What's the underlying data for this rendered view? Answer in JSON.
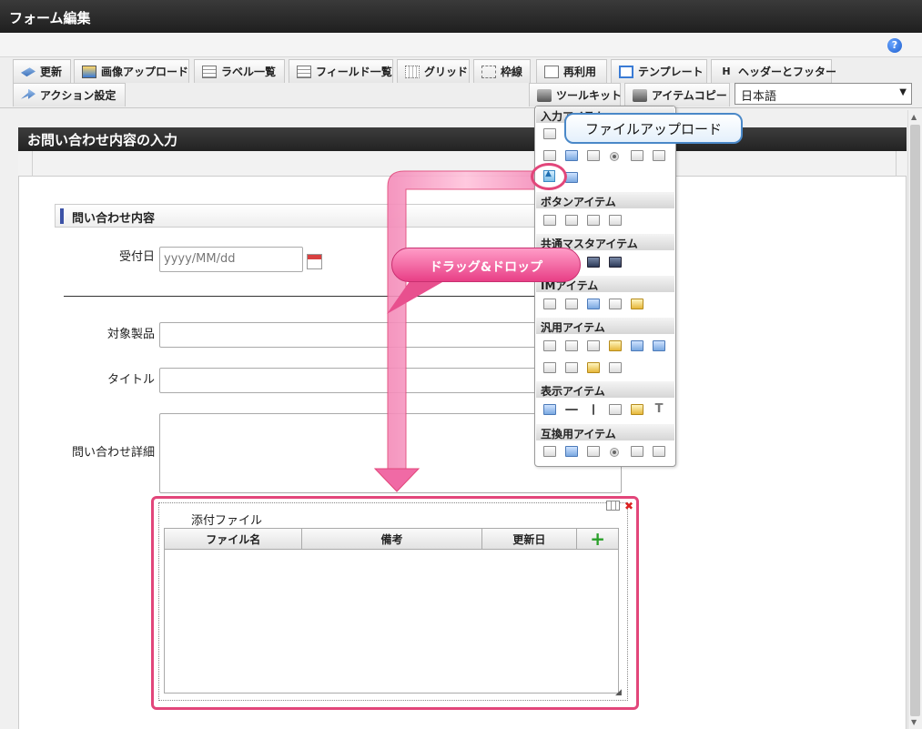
{
  "window": {
    "title": "フォーム編集"
  },
  "toolbar": {
    "row1": [
      "更新",
      "画像アップロード",
      "ラベル一覧",
      "フィールド一覧",
      "グリッド",
      "枠線",
      "再利用",
      "テンプレート",
      "ヘッダーとフッター"
    ],
    "action": "アクション設定",
    "toolkit": "ツールキット",
    "itemcopy": "アイテムコピー",
    "language": "日本語"
  },
  "form": {
    "title": "お問い合わせ内容の入力",
    "section": "問い合わせ内容",
    "fields": {
      "date_label": "受付日",
      "date_placeholder": "yyyy/MM/dd",
      "product_label": "対象製品",
      "title_label": "タイトル",
      "detail_label": "問い合わせ詳細"
    },
    "attachment": {
      "title": "添付ファイル",
      "columns": [
        "ファイル名",
        "備考",
        "更新日"
      ],
      "add": "+"
    }
  },
  "palette": {
    "sections": [
      "入力アイテム",
      "ボタンアイテム",
      "共通マスタアイテム",
      "IMアイテム",
      "汎用アイテム",
      "表示アイテム",
      "互換用アイテム"
    ]
  },
  "callouts": {
    "tooltip": "ファイルアップロード",
    "drag": "ドラッグ&ドロップ"
  },
  "colors": {
    "accent": "#e2467a",
    "header": "#2a2a2a",
    "tooltip_border": "#4a88c8"
  }
}
